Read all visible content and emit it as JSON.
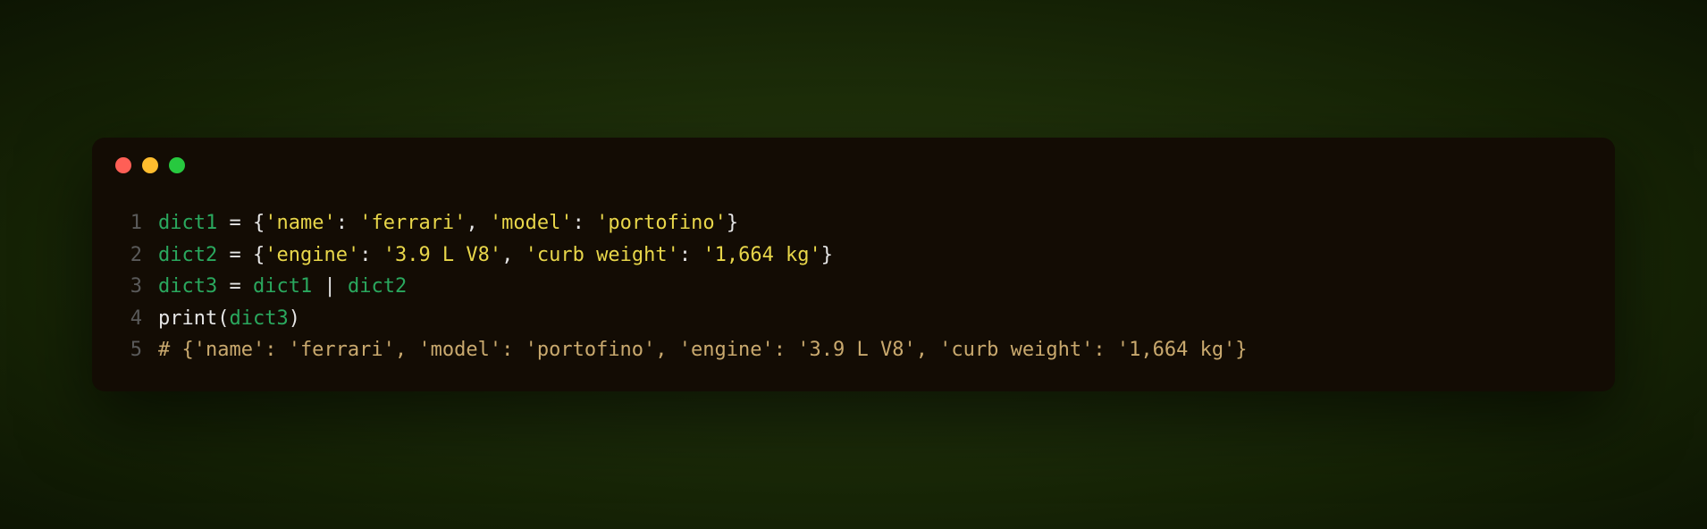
{
  "editor": {
    "traffic_lights": [
      "red",
      "yellow",
      "green"
    ],
    "lines": [
      {
        "num": "1"
      },
      {
        "num": "2"
      },
      {
        "num": "3"
      },
      {
        "num": "4"
      },
      {
        "num": "5"
      }
    ],
    "code": {
      "l1": {
        "var": "dict1",
        "eq": " = ",
        "open": "{",
        "k1": "'name'",
        "c1": ": ",
        "v1": "'ferrari'",
        "sep": ", ",
        "k2": "'model'",
        "c2": ": ",
        "v2": "'portofino'",
        "close": "}"
      },
      "l2": {
        "var": "dict2",
        "eq": " = ",
        "open": "{",
        "k1": "'engine'",
        "c1": ": ",
        "v1": "'3.9 L V8'",
        "sep": ", ",
        "k2": "'curb weight'",
        "c2": ": ",
        "v2": "'1,664 kg'",
        "close": "}"
      },
      "l3": {
        "var": "dict3",
        "eq": " = ",
        "a": "dict1",
        "pipe": " | ",
        "b": "dict2"
      },
      "l4": {
        "func": "print",
        "open": "(",
        "arg": "dict3",
        "close": ")"
      },
      "l5": {
        "comment": "# {'name': 'ferrari', 'model': 'portofino', 'engine': '3.9 L V8', 'curb weight': '1,664 kg'}"
      }
    }
  }
}
